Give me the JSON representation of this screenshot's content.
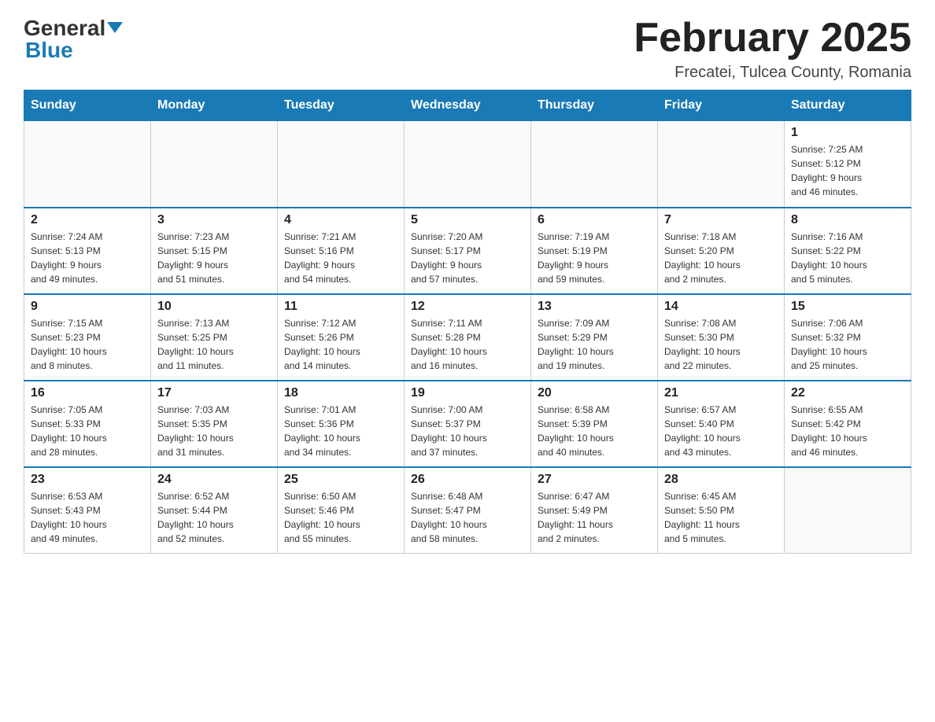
{
  "header": {
    "logo": {
      "general": "General",
      "blue": "Blue"
    },
    "title": "February 2025",
    "location": "Frecatei, Tulcea County, Romania"
  },
  "weekdays": [
    "Sunday",
    "Monday",
    "Tuesday",
    "Wednesday",
    "Thursday",
    "Friday",
    "Saturday"
  ],
  "weeks": [
    [
      {
        "day": "",
        "info": ""
      },
      {
        "day": "",
        "info": ""
      },
      {
        "day": "",
        "info": ""
      },
      {
        "day": "",
        "info": ""
      },
      {
        "day": "",
        "info": ""
      },
      {
        "day": "",
        "info": ""
      },
      {
        "day": "1",
        "info": "Sunrise: 7:25 AM\nSunset: 5:12 PM\nDaylight: 9 hours\nand 46 minutes."
      }
    ],
    [
      {
        "day": "2",
        "info": "Sunrise: 7:24 AM\nSunset: 5:13 PM\nDaylight: 9 hours\nand 49 minutes."
      },
      {
        "day": "3",
        "info": "Sunrise: 7:23 AM\nSunset: 5:15 PM\nDaylight: 9 hours\nand 51 minutes."
      },
      {
        "day": "4",
        "info": "Sunrise: 7:21 AM\nSunset: 5:16 PM\nDaylight: 9 hours\nand 54 minutes."
      },
      {
        "day": "5",
        "info": "Sunrise: 7:20 AM\nSunset: 5:17 PM\nDaylight: 9 hours\nand 57 minutes."
      },
      {
        "day": "6",
        "info": "Sunrise: 7:19 AM\nSunset: 5:19 PM\nDaylight: 9 hours\nand 59 minutes."
      },
      {
        "day": "7",
        "info": "Sunrise: 7:18 AM\nSunset: 5:20 PM\nDaylight: 10 hours\nand 2 minutes."
      },
      {
        "day": "8",
        "info": "Sunrise: 7:16 AM\nSunset: 5:22 PM\nDaylight: 10 hours\nand 5 minutes."
      }
    ],
    [
      {
        "day": "9",
        "info": "Sunrise: 7:15 AM\nSunset: 5:23 PM\nDaylight: 10 hours\nand 8 minutes."
      },
      {
        "day": "10",
        "info": "Sunrise: 7:13 AM\nSunset: 5:25 PM\nDaylight: 10 hours\nand 11 minutes."
      },
      {
        "day": "11",
        "info": "Sunrise: 7:12 AM\nSunset: 5:26 PM\nDaylight: 10 hours\nand 14 minutes."
      },
      {
        "day": "12",
        "info": "Sunrise: 7:11 AM\nSunset: 5:28 PM\nDaylight: 10 hours\nand 16 minutes."
      },
      {
        "day": "13",
        "info": "Sunrise: 7:09 AM\nSunset: 5:29 PM\nDaylight: 10 hours\nand 19 minutes."
      },
      {
        "day": "14",
        "info": "Sunrise: 7:08 AM\nSunset: 5:30 PM\nDaylight: 10 hours\nand 22 minutes."
      },
      {
        "day": "15",
        "info": "Sunrise: 7:06 AM\nSunset: 5:32 PM\nDaylight: 10 hours\nand 25 minutes."
      }
    ],
    [
      {
        "day": "16",
        "info": "Sunrise: 7:05 AM\nSunset: 5:33 PM\nDaylight: 10 hours\nand 28 minutes."
      },
      {
        "day": "17",
        "info": "Sunrise: 7:03 AM\nSunset: 5:35 PM\nDaylight: 10 hours\nand 31 minutes."
      },
      {
        "day": "18",
        "info": "Sunrise: 7:01 AM\nSunset: 5:36 PM\nDaylight: 10 hours\nand 34 minutes."
      },
      {
        "day": "19",
        "info": "Sunrise: 7:00 AM\nSunset: 5:37 PM\nDaylight: 10 hours\nand 37 minutes."
      },
      {
        "day": "20",
        "info": "Sunrise: 6:58 AM\nSunset: 5:39 PM\nDaylight: 10 hours\nand 40 minutes."
      },
      {
        "day": "21",
        "info": "Sunrise: 6:57 AM\nSunset: 5:40 PM\nDaylight: 10 hours\nand 43 minutes."
      },
      {
        "day": "22",
        "info": "Sunrise: 6:55 AM\nSunset: 5:42 PM\nDaylight: 10 hours\nand 46 minutes."
      }
    ],
    [
      {
        "day": "23",
        "info": "Sunrise: 6:53 AM\nSunset: 5:43 PM\nDaylight: 10 hours\nand 49 minutes."
      },
      {
        "day": "24",
        "info": "Sunrise: 6:52 AM\nSunset: 5:44 PM\nDaylight: 10 hours\nand 52 minutes."
      },
      {
        "day": "25",
        "info": "Sunrise: 6:50 AM\nSunset: 5:46 PM\nDaylight: 10 hours\nand 55 minutes."
      },
      {
        "day": "26",
        "info": "Sunrise: 6:48 AM\nSunset: 5:47 PM\nDaylight: 10 hours\nand 58 minutes."
      },
      {
        "day": "27",
        "info": "Sunrise: 6:47 AM\nSunset: 5:49 PM\nDaylight: 11 hours\nand 2 minutes."
      },
      {
        "day": "28",
        "info": "Sunrise: 6:45 AM\nSunset: 5:50 PM\nDaylight: 11 hours\nand 5 minutes."
      },
      {
        "day": "",
        "info": ""
      }
    ]
  ]
}
